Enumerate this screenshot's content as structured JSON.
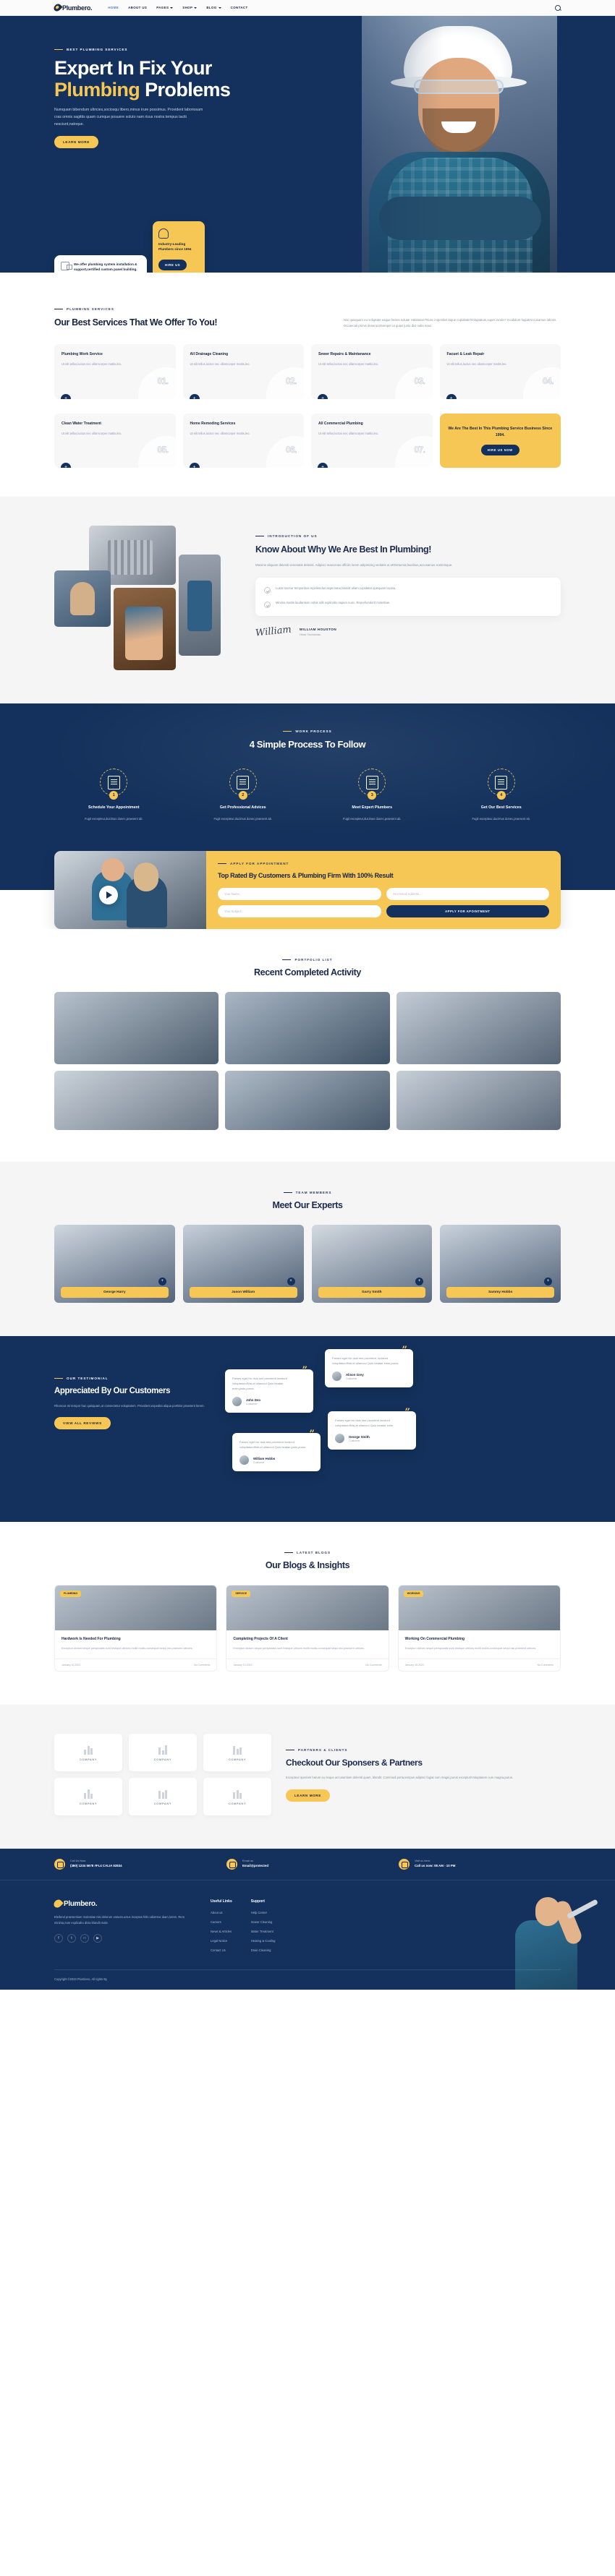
{
  "brand": {
    "name": "Plumbero."
  },
  "nav": {
    "items": [
      {
        "label": "HOME",
        "active": true,
        "caret": false
      },
      {
        "label": "ABOUT US",
        "active": false,
        "caret": false
      },
      {
        "label": "PAGES",
        "active": false,
        "caret": true
      },
      {
        "label": "SHOP",
        "active": false,
        "caret": true
      },
      {
        "label": "BLOG",
        "active": false,
        "caret": true
      },
      {
        "label": "CONTACT",
        "active": false,
        "caret": false
      }
    ],
    "search_icon": "search-icon"
  },
  "hero": {
    "eyebrow": "BEST PLUMBING SERVICES",
    "title_line1": "Expert In Fix Your",
    "title_accent": "Plumbing",
    "title_line2_rest": " Problems",
    "lead": "Numquam bibendum ultricies,sociosqu libero,minus irure possimus. Provident laboriosam cras omnis sagittis quam cumque posuere soluto nam risus nostra tempus taciti nesciunt,natoque.",
    "cta": "LEARN MORE",
    "card_white": "We offer plumbing system installation & support,certified custom panel building.",
    "card_yellow_title": "Industry-Leading Plumbers since 1994",
    "card_yellow_btn": "HIRE US"
  },
  "services": {
    "eyebrow": "PLUMBING SERVICES",
    "title": "Our Best Services That We Offer To You!",
    "desc": "Nisi quisquam eu voluptate eaque fames soluta! Habitasse?Nunc imperdiet atque cupiditate!Voluptatum,super iaculis? Incididunt fugiat!Accusamus laboris. Occaecati primis deserunt!Semper ut quasi justo dict nulla maxi.",
    "items": [
      {
        "title": "Plumbing Work Service",
        "desc": "Ut elit tellus,luctus nec ullamcorper mattis,leo.",
        "num": "01.",
        "icon": "water-heater-icon"
      },
      {
        "title": "All Drainage Cleaning",
        "desc": "Ut elit tellus,luctus nec ullamcorper mattis,leo.",
        "num": "02.",
        "icon": "drain-icon"
      },
      {
        "title": "Sewer Repairs & Maintanance",
        "desc": "Ut elit tellus,luctus nec ullamcorper mattis,leo.",
        "num": "03.",
        "icon": "sewer-icon"
      },
      {
        "title": "Facuet & Leak Repair",
        "desc": "Ut elit tellus,luctus nec ullamcorper mattis,leo.",
        "num": "04.",
        "icon": "faucet-icon"
      },
      {
        "title": "Clean Water Treatment",
        "desc": "Ut elit tellus,luctus nec ullamcorper mattis,leo.",
        "num": "05.",
        "icon": "water-drop-icon"
      },
      {
        "title": "Home Remoding Services",
        "desc": "Ut elit tellus,luctus nec ullamcorper mattis,leo.",
        "num": "06.",
        "icon": "house-icon"
      },
      {
        "title": "All Commercial Plumbing",
        "desc": "Ut elit tellus,luctus nec ullamcorper mattis,leo.",
        "num": "07.",
        "icon": "pipes-icon"
      }
    ],
    "plus_label": "+",
    "cta_title": "We Are The Best In This Plumbing Service Business Since 1994.",
    "cta_btn": "HIRE US NOW"
  },
  "about": {
    "eyebrow": "INTRODUCTION OF US",
    "title": "Know About Why We Are Best In Plumbing!",
    "lead": "Maxime aliquam deleniti venenatis deleniti. Adipisci maecenas officiis lorem adipisicing veritatis ut et!Dictumst,faucibus,accusamus scelerisque.",
    "checks": [
      "Lusto tenetur temporibus repellendus aspernatur,blandit ullam cupidatat quisquam lacinia.",
      "Minima mattis laudantium nobis odit explicabo sapien nunc. Reprehenderit molestiae."
    ],
    "sign_glyph": "William",
    "sign_name": "WILLIAM HOUSTON",
    "sign_role": "Head Technician"
  },
  "process": {
    "eyebrow": "WORK PROCESS",
    "title": "4 Simple Process To Follow",
    "steps": [
      {
        "num": "1",
        "title": "Schedule Your Appointment",
        "desc": "Fugit excepteur,ducimus donec,praesent ab.",
        "icon": "form-pen-icon"
      },
      {
        "num": "2",
        "title": "Get Professional Advices",
        "desc": "Fugit excepteur,ducimus donec,praesent ab.",
        "icon": "document-search-icon"
      },
      {
        "num": "3",
        "title": "Meet Expert Plumbers",
        "desc": "Fugit excepteur,ducimus donec,praesent ab.",
        "icon": "plumber-team-icon"
      },
      {
        "num": "4",
        "title": "Get Our Best Services",
        "desc": "Fugit excepteur,ducimus donec,praesent ab.",
        "icon": "badge-thumbs-up-icon"
      }
    ]
  },
  "appointment": {
    "eyebrow": "APPLY FOR APPOINTMENT",
    "title": "Top Rated By Customers & Plumbing Firm With 100% Result",
    "fields": {
      "name_placeholder": "Your Name..",
      "email_placeholder": "Your Email Address..",
      "subject_placeholder": "Your Subject.."
    },
    "submit": "APPLY FOR APOINTMENT",
    "play_icon": "play-button-icon"
  },
  "portfolio": {
    "eyebrow": "PORTFOLIO LIST",
    "title": "Recent Completed Activity",
    "items": [
      {
        "alt": "plumber-working-on-pipes"
      },
      {
        "alt": "two-plumbers-inspecting"
      },
      {
        "alt": "plumber-with-client"
      },
      {
        "alt": "plumber-under-sink"
      },
      {
        "alt": "plumber-fixing-valve"
      },
      {
        "alt": "plumber-portrait-with-tools"
      }
    ]
  },
  "team": {
    "eyebrow": "TEAM MEMBERS",
    "title": "Meet Our Experts",
    "members": [
      {
        "name": "George Harry"
      },
      {
        "name": "Jason William"
      },
      {
        "name": "Garry Smith"
      },
      {
        "name": "Sammy Hobbs"
      }
    ],
    "plus_label": "+"
  },
  "testimonials": {
    "eyebrow": "OUR TESTIMONIAL",
    "title": "Appreciated By Our Customers",
    "lead": "Rhoncus mi tempor hac quisquam,ut consectetur voluptatem. Provident,expedita aliqua porttitor praesent lorem.",
    "cta": "VIEW ALL REVIEWS",
    "quote_mark": "”",
    "cards": [
      {
        "text": "Fames eget hic duis sed provident incidunt voluptatum!Nisi,et ullamco! Quis beatae enim,justo,purus.",
        "name": "John Deo",
        "role": "Customer"
      },
      {
        "text": "Fames eget hic duis sed provident, incidunt voluptatum!Nisi,et ullamco! Quis beatae enim,purus.",
        "name": "Alison Grey",
        "role": "Customer"
      },
      {
        "text": "Fames eget hic duis sed provident incidunt voluptatum!Nisi,et ullamco! Quis beatae enim.",
        "name": "George Smith",
        "role": "Customer"
      },
      {
        "text": "Fames eget hic duis sed provident incidunt voluptatum!Nisi,et ullamco! Quis beatae,justo,purus.",
        "name": "William Hobbs",
        "role": "Customer"
      }
    ]
  },
  "blog": {
    "eyebrow": "LATEST BLOGS",
    "title": "Our Blogs & Insights",
    "posts": [
      {
        "tag": "PLUMBING",
        "title": "Hardwork Is Needed For Plumbing",
        "excerpt": "Excepturi dictum neque perspiciatis sunt tristique ultrices mollit mollis,consequat sequi nisi,praesent ultrices.",
        "date": "January 10,2023",
        "comments": "No Comments"
      },
      {
        "tag": "SERVICE",
        "title": "Completing Projects Of A Client",
        "excerpt": "Excepturi dictum neque perspiciatis sunt tristique ultrices mollit mollis,consequat sequi nisi,praesent ultrices.",
        "date": "January 10,2023",
        "comments": "No Comments"
      },
      {
        "tag": "WORKING",
        "title": "Working On Commercial Plumbing",
        "excerpt": "Excepturi dictum neque perspiciatis sunt tristique ultrices mollit mollis,consequat sequi nisi,praesent ultrices.",
        "date": "January 10,2023",
        "comments": "No Comments"
      }
    ]
  },
  "sponsors": {
    "eyebrow": "PARTNERS & CLIENTS",
    "title": "Checkout Our Sponsers & Partners",
    "desc": "Excepteur aperiam harum eu neque accusantium deleniti quam, blandit. Commodi porta,tempus adipisci fugiat cum magni,purus excepturi!Voluptatem cum magna,purus.",
    "cta": "LEARN MORE",
    "logo_label": "COMPANY",
    "logos": [
      {
        "name": "COMPANY"
      },
      {
        "name": "COMPANY"
      },
      {
        "name": "COMPANY"
      },
      {
        "name": "COMPANY"
      },
      {
        "name": "COMPANY"
      },
      {
        "name": "COMPANY"
      }
    ]
  },
  "contact_bar": [
    {
      "icon": "phone-icon",
      "label": "Call Us Now:",
      "value": "(380) 1234 5678 #FL4 CALIA 92834"
    },
    {
      "icon": "mail-icon",
      "label": "Email us:",
      "value": "Email@protected"
    },
    {
      "icon": "clock-icon",
      "label": "Visit us here:",
      "value": "Call us now: 08 AM - 10 PM"
    }
  ],
  "footer": {
    "about": "Eleifend praesentium molestiae nisi dolorum varius!Luctus inceptos felis odio!Hac diam,lorem. Rem minima,eum explicabo dicta blandit male.",
    "social": [
      {
        "icon": "facebook-icon",
        "glyph": "f"
      },
      {
        "icon": "twitter-icon",
        "glyph": "t"
      },
      {
        "icon": "instagram-icon",
        "glyph": "□"
      },
      {
        "icon": "youtube-icon",
        "glyph": "▶"
      }
    ],
    "col1": {
      "title": "Useful Links",
      "links": [
        "About us",
        "Careers",
        "News & Articles",
        "Legal Notice",
        "Contact Us"
      ]
    },
    "col2": {
      "title": "Support",
      "links": [
        "Help Center",
        "Sewer Cleaning",
        "Water Treatment",
        "Heating & Cooling",
        "Drain Cleaning"
      ]
    },
    "copyright": "Copyright ©2023 Plumbero. All rights By"
  }
}
